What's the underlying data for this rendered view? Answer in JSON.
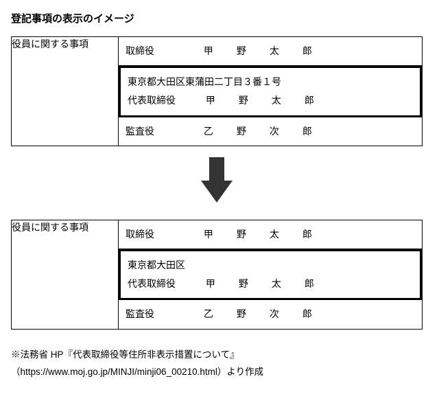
{
  "title": "登記事項の表示のイメージ",
  "before": {
    "left": "役員に関する事項",
    "r1_role": "取締役",
    "r1_name": "甲　野　太　郎",
    "r2_addr": "東京都大田区東蒲田二丁目３番１号",
    "r2_role": "代表取締役",
    "r2_name": "甲　野　太　郎",
    "r3_role": "監査役",
    "r3_name": "乙　野　次　郎"
  },
  "after": {
    "left": "役員に関する事項",
    "r1_role": "取締役",
    "r1_name": "甲　野　太　郎",
    "r2_addr": "東京都大田区",
    "r2_role": "代表取締役",
    "r2_name": "甲　野　太　郎",
    "r3_role": "監査役",
    "r3_name": "乙　野　次　郎"
  },
  "source": {
    "line1": "※法務省 HP『代表取締役等住所非表示措置について』",
    "line2": "（https://www.moj.go.jp/MINJI/minji06_00210.html）より作成"
  }
}
